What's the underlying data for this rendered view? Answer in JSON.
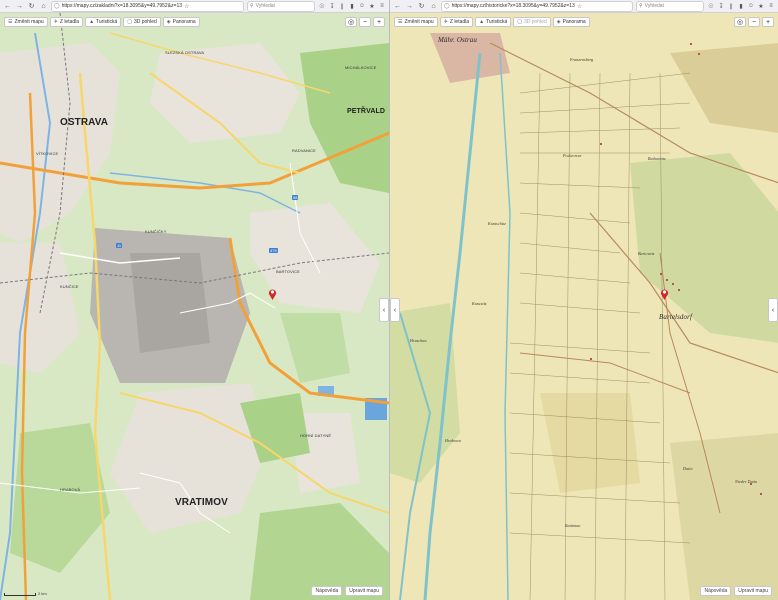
{
  "left": {
    "browser": {
      "url": "https://mapy.cz/zakladni?x=18.3095&y=49.7952&z=13",
      "search_placeholder": "Vyhledat"
    },
    "map_toolbar": [
      {
        "label": "Změnit mapu",
        "icon": "layers-icon"
      },
      {
        "label": "Z letadla",
        "icon": "plane-icon"
      },
      {
        "label": "Turistická",
        "icon": "hiker-icon"
      },
      {
        "label": "3D pohled",
        "icon": "cube-icon"
      },
      {
        "label": "Panorama",
        "icon": "panorama-icon"
      }
    ],
    "places": [
      {
        "text": "OSTRAVA",
        "cls": "big"
      },
      {
        "text": "PETŘVALD",
        "cls": "mid"
      },
      {
        "text": "SLEZSKÁ OSTRAVA",
        "cls": "small"
      },
      {
        "text": "MICHÁLKOVICE",
        "cls": "small"
      },
      {
        "text": "RADVANICE",
        "cls": "small"
      },
      {
        "text": "VÍTKOVICE",
        "cls": "small"
      },
      {
        "text": "KUNČIČKY",
        "cls": "small"
      },
      {
        "text": "KUNČICE",
        "cls": "small"
      },
      {
        "text": "BARTOVICE",
        "cls": "small"
      },
      {
        "text": "HORNÍ DATYNĚ",
        "cls": "small"
      },
      {
        "text": "HRABOVÁ",
        "cls": "small"
      },
      {
        "text": "VRATIMOV",
        "cls": "big"
      }
    ],
    "bottom": {
      "feedback": "Nápověda",
      "report": "Upravit mapu"
    },
    "scale": "2 km"
  },
  "right": {
    "browser": {
      "url": "https://mapy.cz/historicke?x=18.3095&y=49.7952&z=13",
      "search_placeholder": "Vyhledat"
    },
    "map_toolbar": [
      {
        "label": "Změnit mapu",
        "icon": "layers-icon"
      },
      {
        "label": "Z letadla",
        "icon": "plane-icon"
      },
      {
        "label": "Turistická",
        "icon": "hiker-icon"
      },
      {
        "label": "3D pohled",
        "icon": "cube-icon"
      },
      {
        "label": "Panorama",
        "icon": "panorama-icon"
      }
    ],
    "places": [
      {
        "text": "Mähr. Ostrau",
        "cls": "mid"
      },
      {
        "text": "Franzensberg",
        "cls": "small"
      },
      {
        "text": "Podworcze",
        "cls": "small"
      },
      {
        "text": "Radwanitz",
        "cls": "small"
      },
      {
        "text": "Kuntschitz",
        "cls": "small"
      },
      {
        "text": "Bartowitz",
        "cls": "small"
      },
      {
        "text": "Bartelsdorf",
        "cls": "mid"
      },
      {
        "text": "Kunczitz",
        "cls": "small"
      },
      {
        "text": "Hruschau",
        "cls": "small"
      },
      {
        "text": "Hrabowa",
        "cls": "small"
      },
      {
        "text": "Datin",
        "cls": "small"
      },
      {
        "text": "Rattimau",
        "cls": "small"
      },
      {
        "text": "Nieder Datin",
        "cls": "small"
      }
    ],
    "bottom": {
      "feedback": "Nápověda",
      "report": "Upravit mapu"
    }
  },
  "colors": {
    "modern_green": "#cfe3b0",
    "modern_forest": "#a9d188",
    "modern_urban": "#e6e2da",
    "industrial": "#b9b6b1",
    "highway": "#f2a03a",
    "primary_road": "#f7d66b",
    "water": "#7fb3e3",
    "historic_paper": "#efe6b8",
    "historic_green": "#c8d79a",
    "historic_water": "#7fc2c9",
    "pin_red": "#d0282a"
  }
}
